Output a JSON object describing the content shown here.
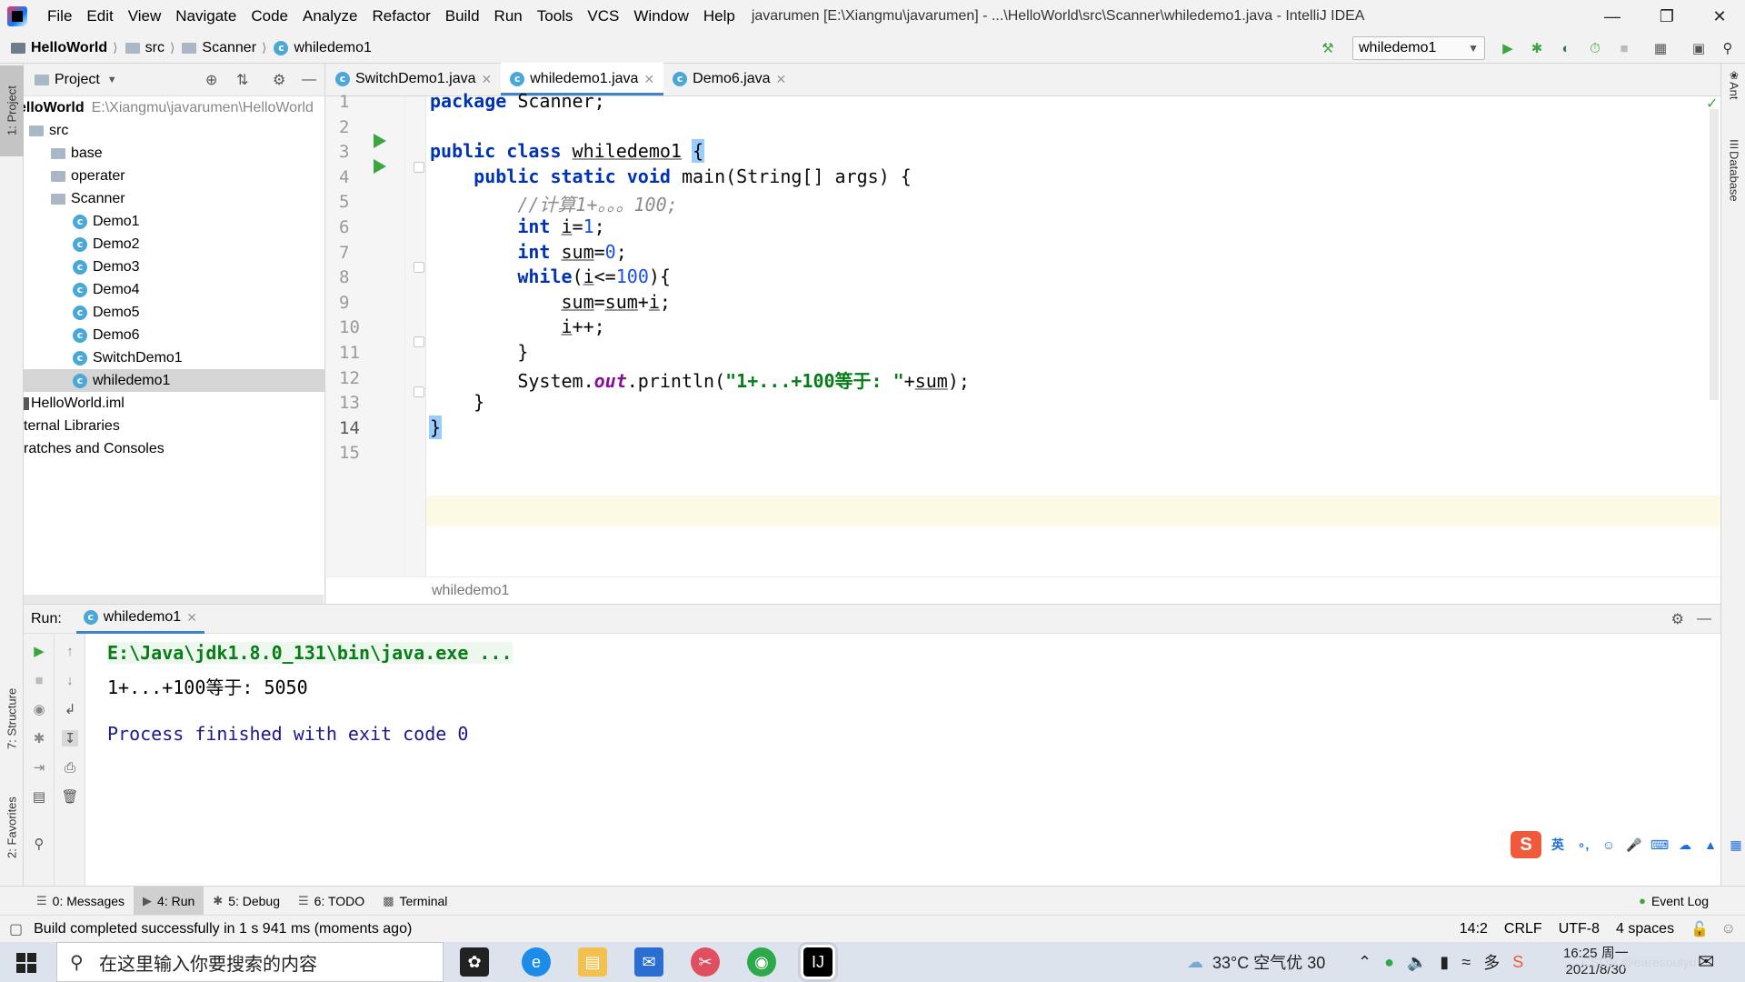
{
  "menubar": {
    "items": [
      "File",
      "Edit",
      "View",
      "Navigate",
      "Code",
      "Analyze",
      "Refactor",
      "Build",
      "Run",
      "Tools",
      "VCS",
      "Window",
      "Help"
    ],
    "title": "javarumen [E:\\Xiangmu\\javarumen] - ...\\HelloWorld\\src\\Scanner\\whiledemo1.java - IntelliJ IDEA"
  },
  "navbar": {
    "crumbs": [
      "HelloWorld",
      "src",
      "Scanner",
      "whiledemo1"
    ],
    "run_config": "whiledemo1"
  },
  "left_stripe": {
    "project": "1: Project",
    "structure": "7: Structure",
    "favorites": "2: Favorites"
  },
  "right_stripe": {
    "ant": "Ant",
    "database": "Database"
  },
  "project": {
    "header": "Project",
    "root_name": "elloWorld",
    "root_path": "E:\\Xiangmu\\javarumen\\HelloWorld",
    "tree": [
      {
        "label": "src",
        "kind": "folder",
        "indent": 0
      },
      {
        "label": "base",
        "kind": "folder",
        "indent": 1
      },
      {
        "label": "operater",
        "kind": "folder",
        "indent": 1
      },
      {
        "label": "Scanner",
        "kind": "folder",
        "indent": 1
      },
      {
        "label": "Demo1",
        "kind": "class",
        "indent": 2
      },
      {
        "label": "Demo2",
        "kind": "class",
        "indent": 2
      },
      {
        "label": "Demo3",
        "kind": "class",
        "indent": 2
      },
      {
        "label": "Demo4",
        "kind": "class",
        "indent": 2
      },
      {
        "label": "Demo5",
        "kind": "class",
        "indent": 2
      },
      {
        "label": "Demo6",
        "kind": "class",
        "indent": 2
      },
      {
        "label": "SwitchDemo1",
        "kind": "class",
        "indent": 2
      },
      {
        "label": "whiledemo1",
        "kind": "class",
        "indent": 2,
        "selected": true
      },
      {
        "label": "HelloWorld.iml",
        "kind": "file",
        "indent": 0
      },
      {
        "label": "ternal Libraries",
        "kind": "plain",
        "indent": 0
      },
      {
        "label": "ratches and Consoles",
        "kind": "plain",
        "indent": 0
      }
    ]
  },
  "editor_tabs": [
    {
      "label": "SwitchDemo1.java",
      "active": false
    },
    {
      "label": "whiledemo1.java",
      "active": true
    },
    {
      "label": "Demo6.java",
      "active": false
    }
  ],
  "editor": {
    "line_numbers": [
      "1",
      "2",
      "3",
      "4",
      "5",
      "6",
      "7",
      "8",
      "9",
      "10",
      "11",
      "12",
      "13",
      "14",
      "15"
    ],
    "current_line": 14,
    "breadcrumb": "whiledemo1"
  },
  "run_panel": {
    "label": "Run:",
    "tab": "whiledemo1",
    "output": {
      "cmd": "E:\\Java\\jdk1.8.0_131\\bin\\java.exe ...",
      "result": "1+...+100等于: 5050",
      "exit": "Process finished with exit code 0"
    }
  },
  "tool_windows": {
    "messages": "0: Messages",
    "run": "4: Run",
    "debug": "5: Debug",
    "todo": "6: TODO",
    "terminal": "Terminal",
    "event_log": "Event Log"
  },
  "status": {
    "message": "Build completed successfully in 1 s 941 ms (moments ago)",
    "position": "14:2",
    "line_sep": "CRLF",
    "encoding": "UTF-8",
    "indent": "4 spaces"
  },
  "taskbar": {
    "search_placeholder": "在这里输入你要搜索的内容",
    "weather": "33°C 空气优 30",
    "time": "16:25 周一",
    "date": "2021/8/30",
    "watermark": "CSDN @earesoulyu"
  },
  "ime": {
    "lang": "英"
  }
}
